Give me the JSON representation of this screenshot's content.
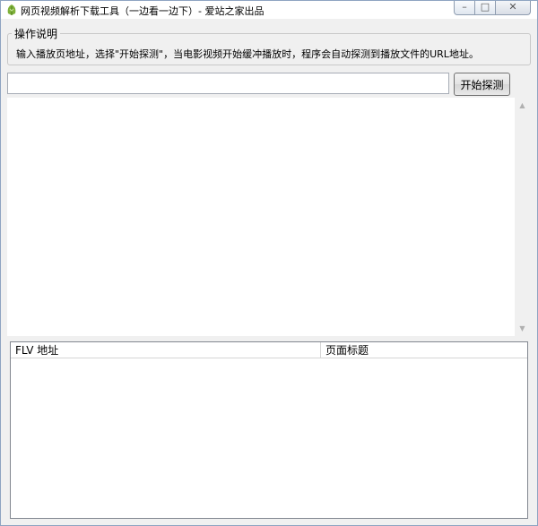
{
  "window": {
    "title": "网页视频解析下载工具（一边看一边下）- 爱站之家出品",
    "icon": "leaf-app-icon",
    "controls": {
      "minimize_icon": "minimize-icon",
      "maximize_icon": "maximize-icon",
      "close_icon": "close-icon"
    }
  },
  "instructions": {
    "group_label": "操作说明",
    "text": "输入播放页地址，选择\"开始探测\"，当电影视频开始缓冲播放时，程序会自动探测到播放文件的URL地址。"
  },
  "url_input": {
    "value": "",
    "placeholder": ""
  },
  "start_button": {
    "label": "开始探测"
  },
  "results_table": {
    "columns": [
      "FLV 地址",
      "页面标题"
    ],
    "rows": []
  },
  "colors": {
    "window_border": "#8ea4c1",
    "client_background": "#f0f0f0",
    "panel_background": "#ffffff"
  }
}
